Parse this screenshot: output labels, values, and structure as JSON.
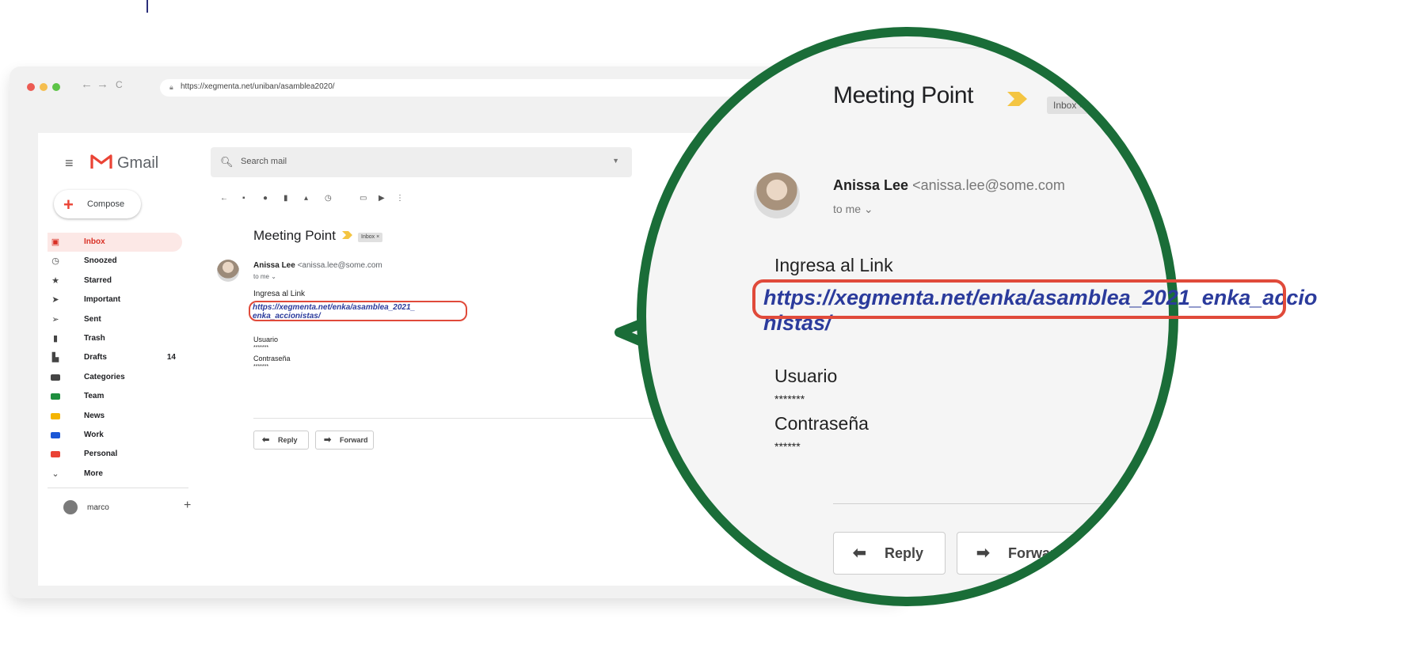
{
  "browser": {
    "url": "https://xegmenta.net/uniban/asamblea2020/",
    "nav_back": "←",
    "nav_forward": "→",
    "nav_reload": "C"
  },
  "gmail": {
    "logo_text": "Gmail",
    "search_placeholder": "Search mail",
    "compose_label": "Compose",
    "sidebar": [
      {
        "label": "Inbox",
        "icon": "inbox-icon",
        "glyph": "▣",
        "active": true
      },
      {
        "label": "Snoozed",
        "icon": "clock-icon",
        "glyph": "◷"
      },
      {
        "label": "Starred",
        "icon": "star-icon",
        "glyph": "★"
      },
      {
        "label": "Important",
        "icon": "important-icon",
        "glyph": "➤"
      },
      {
        "label": "Sent",
        "icon": "send-icon",
        "glyph": "➢"
      },
      {
        "label": "Trash",
        "icon": "trash-icon",
        "glyph": "▮"
      },
      {
        "label": "Drafts",
        "icon": "draft-icon",
        "glyph": "▙",
        "count": "14"
      },
      {
        "label": "Categories",
        "icon": "label-icon",
        "tag": "#444444"
      },
      {
        "label": "Team",
        "icon": "label-icon",
        "tag": "#1e8e3e"
      },
      {
        "label": "News",
        "icon": "label-icon",
        "tag": "#f4b400"
      },
      {
        "label": "Work",
        "icon": "label-icon",
        "tag": "#1a56d6"
      },
      {
        "label": "Personal",
        "icon": "label-icon",
        "tag": "#ea4335"
      },
      {
        "label": "More",
        "icon": "chevron-down-icon",
        "glyph": "⌄"
      }
    ],
    "account_name": "marco",
    "email": {
      "subject": "Meeting Point",
      "inbox_badge": "Inbox ×",
      "sender_name": "Anissa Lee",
      "sender_email": "<anissa.lee@some.com",
      "to": "to me ⌄",
      "body_intro": "Ingresa al Link",
      "link_line1": "https://xegmenta.net/enka/asamblea_2021_",
      "link_line2": "enka_accionistas/",
      "link_big_line1": "https://xegmenta.net/enka/asamblea_2021_enka_accio",
      "link_big_line2": "nistas/",
      "user_label": "Usuario",
      "user_value": "*******",
      "pass_label": "Contraseña",
      "pass_value": "*******",
      "pass_value_zoom": "******",
      "reply_label": "Reply",
      "forward_label": "Forward"
    }
  },
  "colors": {
    "magnifier_border": "#1a6d38",
    "highlight": "#e04a3a",
    "link": "#2b3b9c"
  }
}
